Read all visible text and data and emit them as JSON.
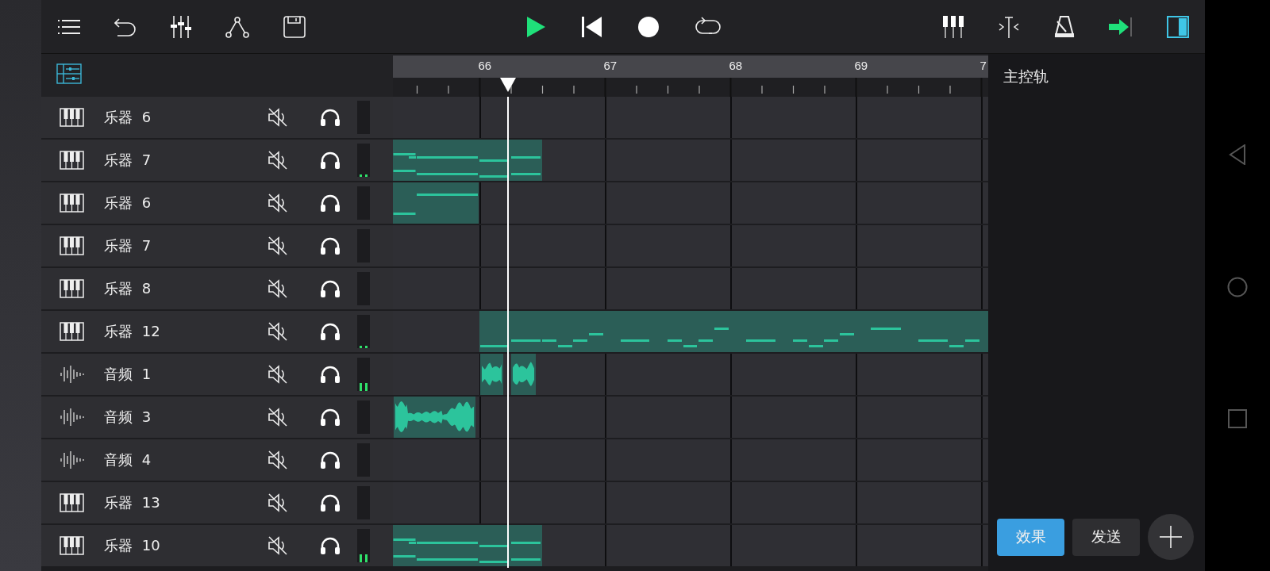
{
  "ruler": {
    "bars": [
      "66",
      "67",
      "68",
      "69",
      "7"
    ]
  },
  "tracks": [
    {
      "kind": "instrument",
      "name": "乐器 6"
    },
    {
      "kind": "instrument",
      "name": "乐器 7",
      "level": 0.06
    },
    {
      "kind": "instrument",
      "name": "乐器 6"
    },
    {
      "kind": "instrument",
      "name": "乐器 7"
    },
    {
      "kind": "instrument",
      "name": "乐器 8"
    },
    {
      "kind": "instrument",
      "name": "乐器 12",
      "level": 0.06
    },
    {
      "kind": "audio",
      "name": "音频 1",
      "level": 0.25
    },
    {
      "kind": "audio",
      "name": "音频 3"
    },
    {
      "kind": "audio",
      "name": "音频 4"
    },
    {
      "kind": "instrument",
      "name": "乐器 13"
    },
    {
      "kind": "instrument",
      "name": "乐器 10",
      "level": 0.25
    }
  ],
  "master_panel": {
    "title": "主控轨",
    "tabs": [
      {
        "label": "效果",
        "selected": true
      },
      {
        "label": "发送",
        "selected": false
      }
    ]
  }
}
